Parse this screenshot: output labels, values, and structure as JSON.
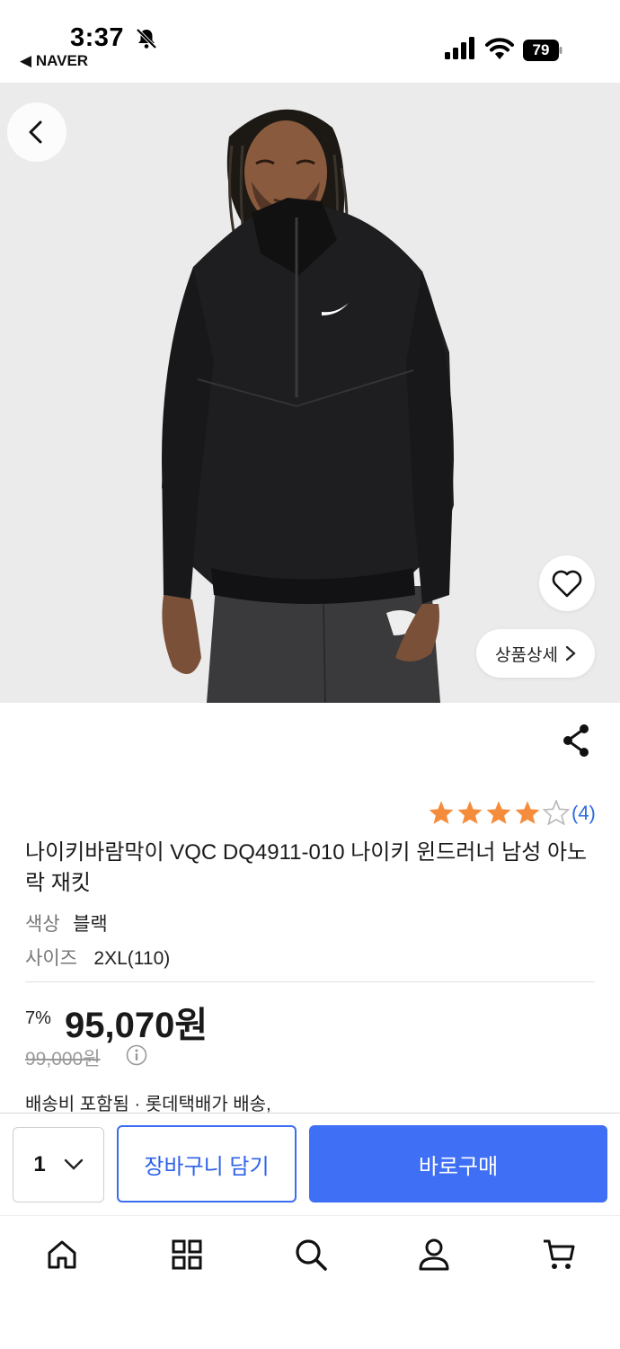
{
  "status": {
    "time": "3:37",
    "back_app": "NAVER",
    "battery": "79"
  },
  "product": {
    "rating_count": "(4)",
    "rating_stars": 4,
    "title": "나이키바람막이 VQC DQ4911-010 나이키 윈드러너 남성 아노락 재킷",
    "color_label": "색상",
    "color_value": "블랙",
    "size_label": "사이즈",
    "size_value": "2XL(110)",
    "discount": "7%",
    "price": "95,070원",
    "original_price": "99,000원",
    "shipping": "배송비 포함됨 · 롯데택배가 배송,"
  },
  "hero": {
    "detail_button": "상품상세"
  },
  "actions": {
    "quantity": "1",
    "cart_button": "장바구니 담기",
    "buy_button": "바로구매"
  },
  "tabbar": {
    "items": [
      "home-icon",
      "grid-icon",
      "search-icon",
      "user-icon",
      "cart-icon"
    ]
  },
  "colors": {
    "accent": "#3e6ff5",
    "star": "#f58c3b",
    "link": "#2e6bde"
  }
}
